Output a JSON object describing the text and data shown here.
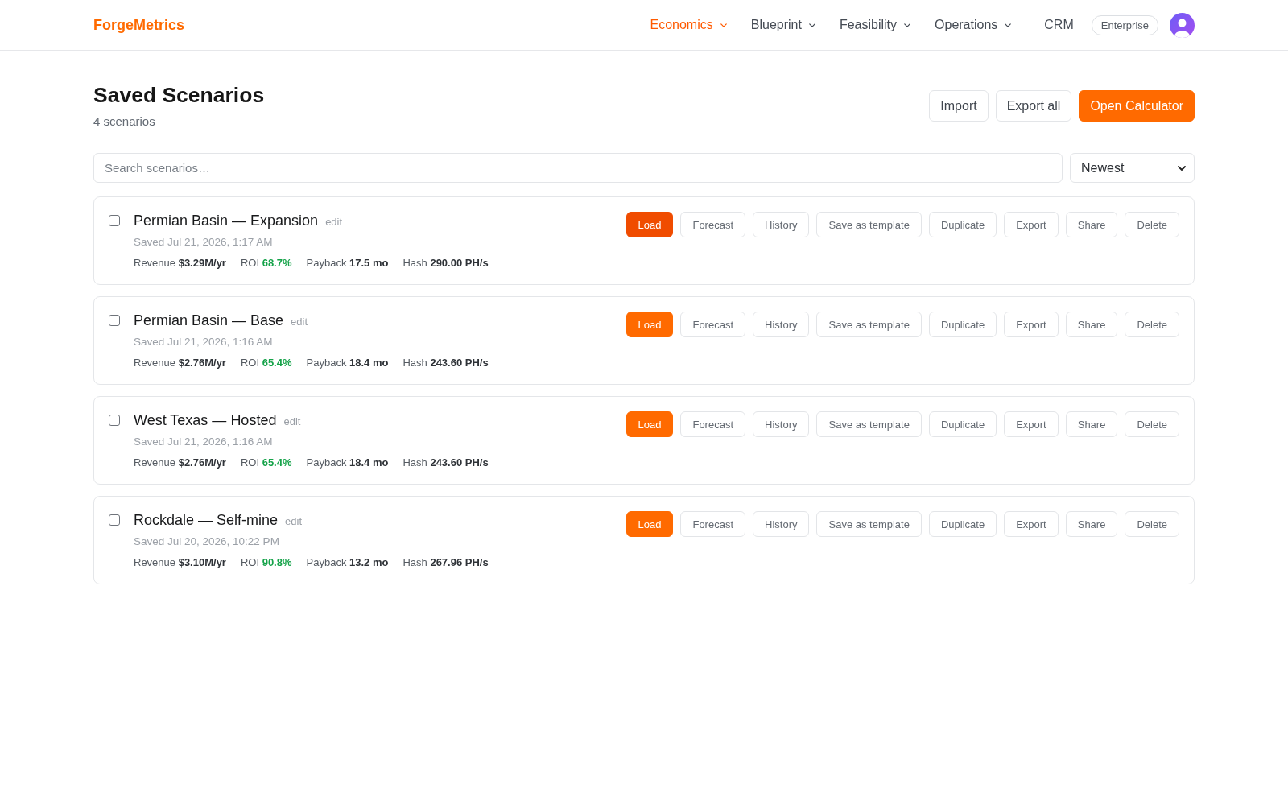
{
  "header": {
    "brand": "ForgeMetrics",
    "nav": [
      {
        "label": "Economics",
        "selected": true,
        "dropdown": true
      },
      {
        "label": "Blueprint",
        "selected": false,
        "dropdown": true
      },
      {
        "label": "Feasibility",
        "selected": false,
        "dropdown": true
      },
      {
        "label": "Operations",
        "selected": false,
        "dropdown": true
      },
      {
        "label": "CRM",
        "selected": false,
        "dropdown": false
      }
    ],
    "plan_badge": "Enterprise"
  },
  "page": {
    "title": "Saved Scenarios",
    "subtitle": "4 scenarios",
    "actions": [
      {
        "label": "Import",
        "kind": "secondary"
      },
      {
        "label": "Export all",
        "kind": "secondary"
      },
      {
        "label": "Open Calculator",
        "kind": "primary"
      }
    ]
  },
  "filters": {
    "search": {
      "placeholder": "Search scenarios…"
    },
    "sort": {
      "value": "Newest"
    }
  },
  "scenarios": [
    {
      "name": "Permian Basin — Expansion",
      "edit_link": "edit",
      "saved": "Saved Jul 21, 2026, 1:17 AM",
      "checked": false,
      "metrics": [
        {
          "label": "Revenue",
          "value": "$3.29M/yr",
          "positive": false
        },
        {
          "label": "ROI",
          "value": "68.7%",
          "positive": true
        },
        {
          "label": "Payback",
          "value": "17.5 mo",
          "positive": false
        },
        {
          "label": "Hash",
          "value": "290.00 PH/s",
          "positive": false
        }
      ],
      "actions": [
        {
          "label": "Load",
          "kind": "primary",
          "hovered": true
        },
        {
          "label": "Forecast",
          "kind": "secondary",
          "hovered": false
        },
        {
          "label": "History",
          "kind": "secondary",
          "hovered": false
        },
        {
          "label": "Save as template",
          "kind": "secondary",
          "hovered": false
        },
        {
          "label": "Duplicate",
          "kind": "secondary",
          "hovered": false
        },
        {
          "label": "Export",
          "kind": "secondary",
          "hovered": false
        },
        {
          "label": "Share",
          "kind": "secondary",
          "hovered": false
        },
        {
          "label": "Delete",
          "kind": "secondary",
          "hovered": false
        }
      ]
    },
    {
      "name": "Permian Basin — Base",
      "edit_link": "edit",
      "saved": "Saved Jul 21, 2026, 1:16 AM",
      "checked": false,
      "metrics": [
        {
          "label": "Revenue",
          "value": "$2.76M/yr",
          "positive": false
        },
        {
          "label": "ROI",
          "value": "65.4%",
          "positive": true
        },
        {
          "label": "Payback",
          "value": "18.4 mo",
          "positive": false
        },
        {
          "label": "Hash",
          "value": "243.60 PH/s",
          "positive": false
        }
      ],
      "actions": [
        {
          "label": "Load",
          "kind": "primary",
          "hovered": false
        },
        {
          "label": "Forecast",
          "kind": "secondary",
          "hovered": false
        },
        {
          "label": "History",
          "kind": "secondary",
          "hovered": false
        },
        {
          "label": "Save as template",
          "kind": "secondary",
          "hovered": false
        },
        {
          "label": "Duplicate",
          "kind": "secondary",
          "hovered": false
        },
        {
          "label": "Export",
          "kind": "secondary",
          "hovered": false
        },
        {
          "label": "Share",
          "kind": "secondary",
          "hovered": false
        },
        {
          "label": "Delete",
          "kind": "secondary",
          "hovered": false
        }
      ]
    },
    {
      "name": "West Texas — Hosted",
      "edit_link": "edit",
      "saved": "Saved Jul 21, 2026, 1:16 AM",
      "checked": false,
      "metrics": [
        {
          "label": "Revenue",
          "value": "$2.76M/yr",
          "positive": false
        },
        {
          "label": "ROI",
          "value": "65.4%",
          "positive": true
        },
        {
          "label": "Payback",
          "value": "18.4 mo",
          "positive": false
        },
        {
          "label": "Hash",
          "value": "243.60 PH/s",
          "positive": false
        }
      ],
      "actions": [
        {
          "label": "Load",
          "kind": "primary",
          "hovered": false
        },
        {
          "label": "Forecast",
          "kind": "secondary",
          "hovered": false
        },
        {
          "label": "History",
          "kind": "secondary",
          "hovered": false
        },
        {
          "label": "Save as template",
          "kind": "secondary",
          "hovered": false
        },
        {
          "label": "Duplicate",
          "kind": "secondary",
          "hovered": false
        },
        {
          "label": "Export",
          "kind": "secondary",
          "hovered": false
        },
        {
          "label": "Share",
          "kind": "secondary",
          "hovered": false
        },
        {
          "label": "Delete",
          "kind": "secondary",
          "hovered": false
        }
      ]
    },
    {
      "name": "Rockdale — Self-mine",
      "edit_link": "edit",
      "saved": "Saved Jul 20, 2026, 10:22 PM",
      "checked": false,
      "metrics": [
        {
          "label": "Revenue",
          "value": "$3.10M/yr",
          "positive": false
        },
        {
          "label": "ROI",
          "value": "90.8%",
          "positive": true
        },
        {
          "label": "Payback",
          "value": "13.2 mo",
          "positive": false
        },
        {
          "label": "Hash",
          "value": "267.96 PH/s",
          "positive": false
        }
      ],
      "actions": [
        {
          "label": "Load",
          "kind": "primary",
          "hovered": false
        },
        {
          "label": "Forecast",
          "kind": "secondary",
          "hovered": false
        },
        {
          "label": "History",
          "kind": "secondary",
          "hovered": false
        },
        {
          "label": "Save as template",
          "kind": "secondary",
          "hovered": false
        },
        {
          "label": "Duplicate",
          "kind": "secondary",
          "hovered": false
        },
        {
          "label": "Export",
          "kind": "secondary",
          "hovered": false
        },
        {
          "label": "Share",
          "kind": "secondary",
          "hovered": false
        },
        {
          "label": "Delete",
          "kind": "secondary",
          "hovered": false
        }
      ]
    }
  ]
}
